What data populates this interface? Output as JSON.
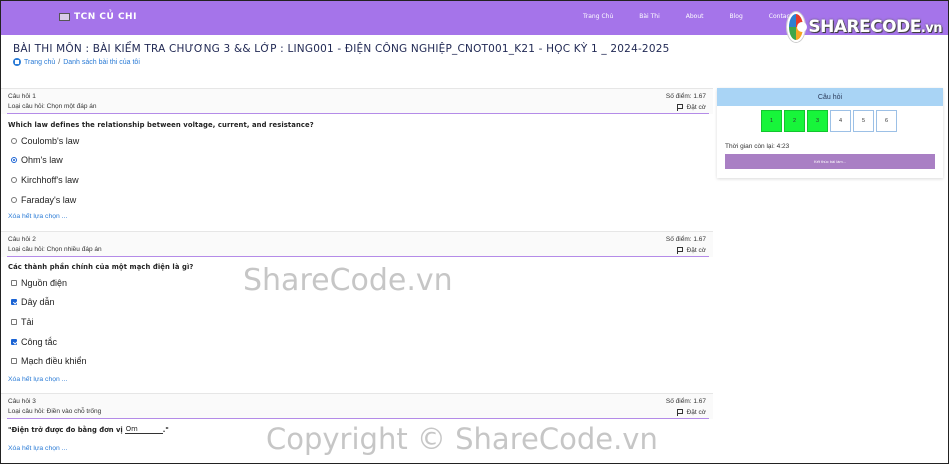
{
  "navbar": {
    "brand": "TCN CỦ CHI",
    "items": [
      "Trang Chủ",
      "Bài Thi",
      "About",
      "Blog",
      "Contact"
    ],
    "logo": {
      "text_main": "SHARECODE",
      "text_tld": ".vn"
    }
  },
  "header": {
    "title": "BÀI THI MÔN : BÀI KIỂM TRA CHƯƠNG 3 && LỚP : LING001 - ĐIỆN CÔNG NGHIỆP_CNOT001_K21 - HỌC KỲ 1 _ 2024-2025",
    "breadcrumb": {
      "home": "Trang chủ",
      "separator": "/",
      "current": "Danh sách bài thi của tôi"
    }
  },
  "questions": [
    {
      "number": "Câu hỏi 1",
      "type": "Loại câu hỏi: Chọn một đáp án",
      "score": "Số điểm: 1.67",
      "flag": "Đặt cờ",
      "text": "Which law defines the relationship between voltage, current, and resistance?",
      "options": [
        {
          "label": "Coulomb's law",
          "checked": false
        },
        {
          "label": "Ohm's law",
          "checked": true
        },
        {
          "label": "Kirchhoff's law",
          "checked": false
        },
        {
          "label": "Faraday's law",
          "checked": false
        }
      ],
      "clear": "Xóa hết lựa chọn ..."
    },
    {
      "number": "Câu hỏi 2",
      "type": "Loại câu hỏi: Chọn nhiều đáp án",
      "score": "Số điểm: 1.67",
      "flag": "Đặt cờ",
      "text": "Các thành phần chính của một mạch điện là gì?",
      "options": [
        {
          "label": "Nguồn điện",
          "checked": false
        },
        {
          "label": "Dây dẫn",
          "checked": true
        },
        {
          "label": "Tải",
          "checked": false
        },
        {
          "label": "Công tắc",
          "checked": true
        },
        {
          "label": "Mạch điều khiển",
          "checked": false
        }
      ],
      "clear": "Xóa hết lựa chọn ..."
    },
    {
      "number": "Câu hỏi 3",
      "type": "Loại câu hỏi: Điền vào chỗ trống",
      "score": "Số điểm: 1.67",
      "flag": "Đặt cờ",
      "text_before": "\"Điện trở được đo bằng đơn vị",
      "answer": "Om",
      "text_after": ".\"",
      "clear": "Xóa hết lựa chọn ..."
    }
  ],
  "sidebar": {
    "title": "Câu hỏi",
    "boxes": [
      {
        "label": "1",
        "answered": true
      },
      {
        "label": "2",
        "answered": true
      },
      {
        "label": "3",
        "answered": true
      },
      {
        "label": "4",
        "answered": false
      },
      {
        "label": "5",
        "answered": false
      },
      {
        "label": "6",
        "answered": false
      }
    ],
    "timer": "Thời gian còn lại: 4:23",
    "finish": "Kết thúc bài làm..."
  },
  "watermarks": [
    "ShareCode.vn",
    "Copyright © ShareCode.vn"
  ],
  "colors": {
    "navbar": "#a574ea",
    "accent_line": "#b48be8",
    "answered_box": "#17f53a",
    "sidebar_head": "#a9d4f5",
    "finish_button": "#a97fc4",
    "link": "#2a7bd6"
  }
}
